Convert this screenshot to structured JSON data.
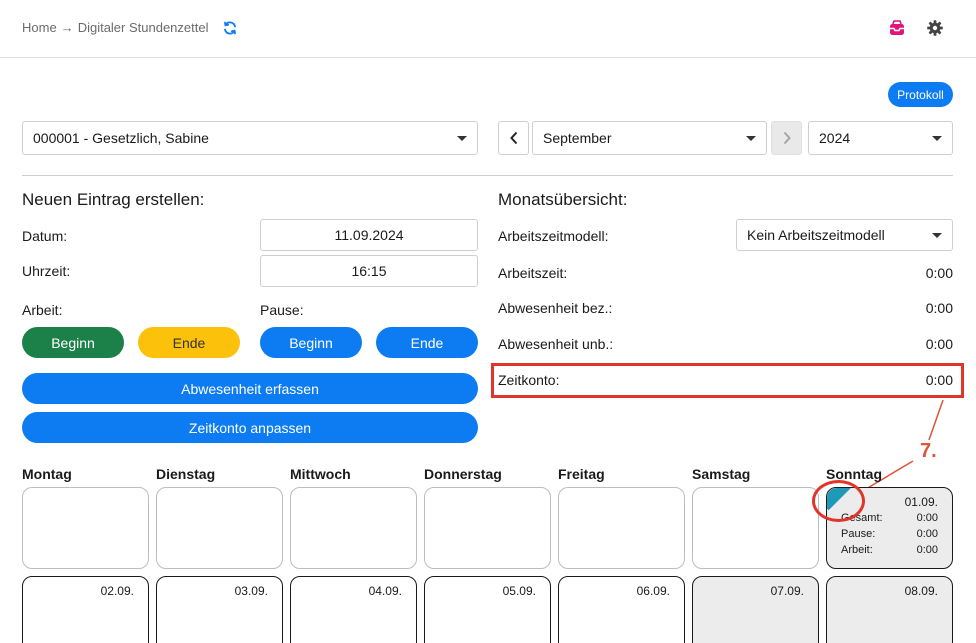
{
  "breadcrumb": {
    "home": "Home",
    "arrow": "→",
    "current": "Digitaler Stundenzettel"
  },
  "icons": {
    "refresh": "refresh-icon",
    "inbox": "inbox-icon",
    "settings": "gear-icon"
  },
  "colors": {
    "accent": "#0d7cf2",
    "green": "#1c8049",
    "yellow": "#fcc10b",
    "highlight": "#e2352a",
    "corner": "#1e99b8"
  },
  "header": {
    "protokoll_label": "Protokoll"
  },
  "selectors": {
    "employee": "000001 - Gesetzlich, Sabine",
    "month": "September",
    "year": "2024",
    "prev": "‹",
    "next": "›"
  },
  "new_entry": {
    "title": "Neuen Eintrag erstellen:",
    "date_label": "Datum:",
    "date_value": "11.09.2024",
    "time_label": "Uhrzeit:",
    "time_value": "16:15",
    "work_label": "Arbeit:",
    "pause_label": "Pause:",
    "work_begin": "Beginn",
    "work_end": "Ende",
    "pause_begin": "Beginn",
    "pause_end": "Ende",
    "absence_button": "Abwesenheit erfassen",
    "adjust_button": "Zeitkonto anpassen"
  },
  "overview": {
    "title": "Monatsübersicht:",
    "model_label": "Arbeitszeitmodell:",
    "model_value": "Kein Arbeitszeitmodell",
    "worktime_label": "Arbeitszeit:",
    "worktime_value": "0:00",
    "abs_paid_label": "Abwesenheit bez.:",
    "abs_paid_value": "0:00",
    "abs_unpaid_label": "Abwesenheit unb.:",
    "abs_unpaid_value": "0:00",
    "account_label": "Zeitkonto:",
    "account_value": "0:00"
  },
  "callout": {
    "number": "7."
  },
  "calendar": {
    "days": [
      "Montag",
      "Dienstag",
      "Mittwoch",
      "Donnerstag",
      "Freitag",
      "Samstag",
      "Sonntag"
    ],
    "week1_sunday": {
      "date": "01.09.",
      "total_label": "Gesamt:",
      "total": "0:00",
      "pause_label": "Pause:",
      "pause": "0:00",
      "work_label": "Arbeit:",
      "work": "0:00"
    },
    "week2": [
      "02.09.",
      "03.09.",
      "04.09.",
      "05.09.",
      "06.09.",
      "07.09.",
      "08.09."
    ]
  }
}
